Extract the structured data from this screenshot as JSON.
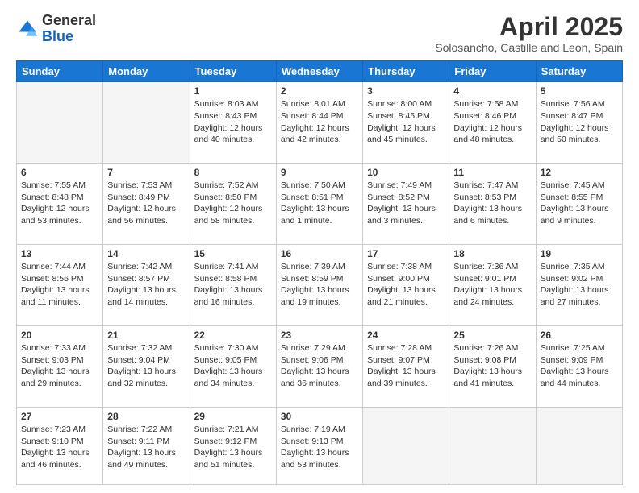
{
  "header": {
    "logo_general": "General",
    "logo_blue": "Blue",
    "title": "April 2025",
    "subtitle": "Solosancho, Castille and Leon, Spain"
  },
  "days_of_week": [
    "Sunday",
    "Monday",
    "Tuesday",
    "Wednesday",
    "Thursday",
    "Friday",
    "Saturday"
  ],
  "weeks": [
    [
      {
        "day": "",
        "info": ""
      },
      {
        "day": "",
        "info": ""
      },
      {
        "day": "1",
        "info": "Sunrise: 8:03 AM\nSunset: 8:43 PM\nDaylight: 12 hours and 40 minutes."
      },
      {
        "day": "2",
        "info": "Sunrise: 8:01 AM\nSunset: 8:44 PM\nDaylight: 12 hours and 42 minutes."
      },
      {
        "day": "3",
        "info": "Sunrise: 8:00 AM\nSunset: 8:45 PM\nDaylight: 12 hours and 45 minutes."
      },
      {
        "day": "4",
        "info": "Sunrise: 7:58 AM\nSunset: 8:46 PM\nDaylight: 12 hours and 48 minutes."
      },
      {
        "day": "5",
        "info": "Sunrise: 7:56 AM\nSunset: 8:47 PM\nDaylight: 12 hours and 50 minutes."
      }
    ],
    [
      {
        "day": "6",
        "info": "Sunrise: 7:55 AM\nSunset: 8:48 PM\nDaylight: 12 hours and 53 minutes."
      },
      {
        "day": "7",
        "info": "Sunrise: 7:53 AM\nSunset: 8:49 PM\nDaylight: 12 hours and 56 minutes."
      },
      {
        "day": "8",
        "info": "Sunrise: 7:52 AM\nSunset: 8:50 PM\nDaylight: 12 hours and 58 minutes."
      },
      {
        "day": "9",
        "info": "Sunrise: 7:50 AM\nSunset: 8:51 PM\nDaylight: 13 hours and 1 minute."
      },
      {
        "day": "10",
        "info": "Sunrise: 7:49 AM\nSunset: 8:52 PM\nDaylight: 13 hours and 3 minutes."
      },
      {
        "day": "11",
        "info": "Sunrise: 7:47 AM\nSunset: 8:53 PM\nDaylight: 13 hours and 6 minutes."
      },
      {
        "day": "12",
        "info": "Sunrise: 7:45 AM\nSunset: 8:55 PM\nDaylight: 13 hours and 9 minutes."
      }
    ],
    [
      {
        "day": "13",
        "info": "Sunrise: 7:44 AM\nSunset: 8:56 PM\nDaylight: 13 hours and 11 minutes."
      },
      {
        "day": "14",
        "info": "Sunrise: 7:42 AM\nSunset: 8:57 PM\nDaylight: 13 hours and 14 minutes."
      },
      {
        "day": "15",
        "info": "Sunrise: 7:41 AM\nSunset: 8:58 PM\nDaylight: 13 hours and 16 minutes."
      },
      {
        "day": "16",
        "info": "Sunrise: 7:39 AM\nSunset: 8:59 PM\nDaylight: 13 hours and 19 minutes."
      },
      {
        "day": "17",
        "info": "Sunrise: 7:38 AM\nSunset: 9:00 PM\nDaylight: 13 hours and 21 minutes."
      },
      {
        "day": "18",
        "info": "Sunrise: 7:36 AM\nSunset: 9:01 PM\nDaylight: 13 hours and 24 minutes."
      },
      {
        "day": "19",
        "info": "Sunrise: 7:35 AM\nSunset: 9:02 PM\nDaylight: 13 hours and 27 minutes."
      }
    ],
    [
      {
        "day": "20",
        "info": "Sunrise: 7:33 AM\nSunset: 9:03 PM\nDaylight: 13 hours and 29 minutes."
      },
      {
        "day": "21",
        "info": "Sunrise: 7:32 AM\nSunset: 9:04 PM\nDaylight: 13 hours and 32 minutes."
      },
      {
        "day": "22",
        "info": "Sunrise: 7:30 AM\nSunset: 9:05 PM\nDaylight: 13 hours and 34 minutes."
      },
      {
        "day": "23",
        "info": "Sunrise: 7:29 AM\nSunset: 9:06 PM\nDaylight: 13 hours and 36 minutes."
      },
      {
        "day": "24",
        "info": "Sunrise: 7:28 AM\nSunset: 9:07 PM\nDaylight: 13 hours and 39 minutes."
      },
      {
        "day": "25",
        "info": "Sunrise: 7:26 AM\nSunset: 9:08 PM\nDaylight: 13 hours and 41 minutes."
      },
      {
        "day": "26",
        "info": "Sunrise: 7:25 AM\nSunset: 9:09 PM\nDaylight: 13 hours and 44 minutes."
      }
    ],
    [
      {
        "day": "27",
        "info": "Sunrise: 7:23 AM\nSunset: 9:10 PM\nDaylight: 13 hours and 46 minutes."
      },
      {
        "day": "28",
        "info": "Sunrise: 7:22 AM\nSunset: 9:11 PM\nDaylight: 13 hours and 49 minutes."
      },
      {
        "day": "29",
        "info": "Sunrise: 7:21 AM\nSunset: 9:12 PM\nDaylight: 13 hours and 51 minutes."
      },
      {
        "day": "30",
        "info": "Sunrise: 7:19 AM\nSunset: 9:13 PM\nDaylight: 13 hours and 53 minutes."
      },
      {
        "day": "",
        "info": ""
      },
      {
        "day": "",
        "info": ""
      },
      {
        "day": "",
        "info": ""
      }
    ]
  ]
}
